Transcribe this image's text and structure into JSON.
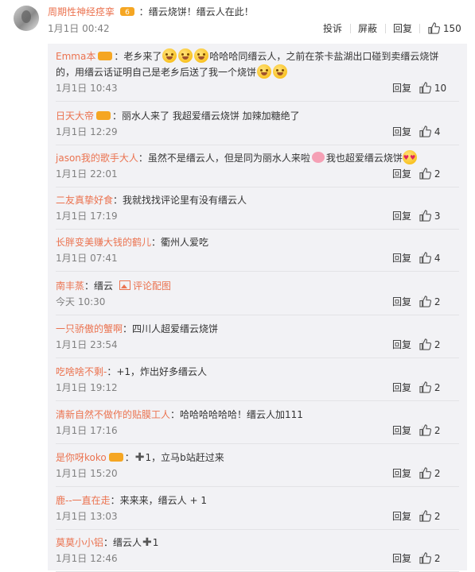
{
  "top": {
    "user": "周期性神经痉挛",
    "colon": "：",
    "text": "缙云烧饼！缙云人在此！",
    "time": "1月1日 00:42",
    "actions": {
      "report": "投诉",
      "block": "屏蔽",
      "reply": "回复",
      "likes": "150"
    }
  },
  "reply_label": "回复",
  "replies": [
    {
      "user": "Emma本",
      "badge": true,
      "text": "：老乡来了",
      "emojis": 3,
      "text2": "哈哈哈同缙云人，之前在茶卡盐湖出口碰到卖缙云烧饼的，用缙云话证明自己是老乡后送了我一个烧饼",
      "emojis2": 2,
      "time": "1月1日 10:43",
      "likes": "10"
    },
    {
      "user": "日天大帝",
      "badge": true,
      "text": "：丽水人来了  我超爱缙云烧饼 加辣加糖绝了",
      "time": "1月1日 12:29",
      "likes": "4"
    },
    {
      "user": "jason我的歌手大人",
      "text": "：虽然不是缙云人，但是同为丽水人来啦",
      "pig": true,
      "text2": "我也超爱缙云烧饼",
      "heart": true,
      "time": "1月1日 22:01",
      "likes": "2"
    },
    {
      "user": "二友真挚好食",
      "text": "：我就找找评论里有没有缙云人",
      "time": "1月1日 17:19",
      "likes": "3"
    },
    {
      "user": "长胖变美赚大钱的鹤儿",
      "text": "：衢州人爱吃",
      "time": "1月1日 07:41",
      "likes": "4"
    },
    {
      "user": "南丰蒸",
      "text": "：缙云",
      "piclink": "评论配图",
      "time": "今天 10:30",
      "likes": "2"
    },
    {
      "user": "一只骄傲的蟹啊",
      "text": "：四川人超爱缙云烧饼",
      "time": "1月1日 23:54",
      "likes": "2"
    },
    {
      "user": "吃啥啥不剩-",
      "text": "：+1，炸出好多缙云人",
      "time": "1月1日 19:12",
      "likes": "2"
    },
    {
      "user": "清新自然不做作的贴膜工人",
      "text": "：哈哈哈哈哈哈！缙云人加111",
      "time": "1月1日 17:16",
      "likes": "2"
    },
    {
      "user": "是你呀koko",
      "badge": true,
      "plus": "✚",
      "text": "1，立马b站赶过来",
      "text_prefix": "：",
      "time": "1月1日 15:20",
      "likes": "2"
    },
    {
      "user": "鹿--一直在走",
      "text": "：来来来，缙云人 + 1",
      "time": "1月1日 13:03",
      "likes": "2"
    },
    {
      "user": "莫莫小小铝",
      "text": "：缙云人",
      "plus_after": "✚",
      "text2": "1",
      "time": "1月1日 12:46",
      "likes": "2"
    }
  ]
}
